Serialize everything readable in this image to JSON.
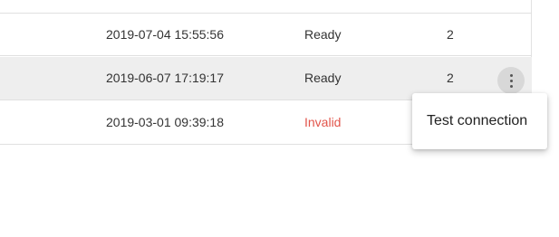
{
  "rows": [
    {
      "date": "2019-07-04 15:55:56",
      "status": "Ready",
      "count": "2"
    },
    {
      "date": "2019-06-07 17:19:17",
      "status": "Ready",
      "count": "2"
    },
    {
      "date": "2019-03-01 09:39:18",
      "status": "Invalid"
    }
  ],
  "row_actions": {
    "icon": "more-vert-icon"
  },
  "context_menu": {
    "items": [
      "Test connection"
    ]
  },
  "colors": {
    "invalid": "#e2554b",
    "selected_row": "#eeeeee",
    "divider": "#e0e0e0"
  }
}
